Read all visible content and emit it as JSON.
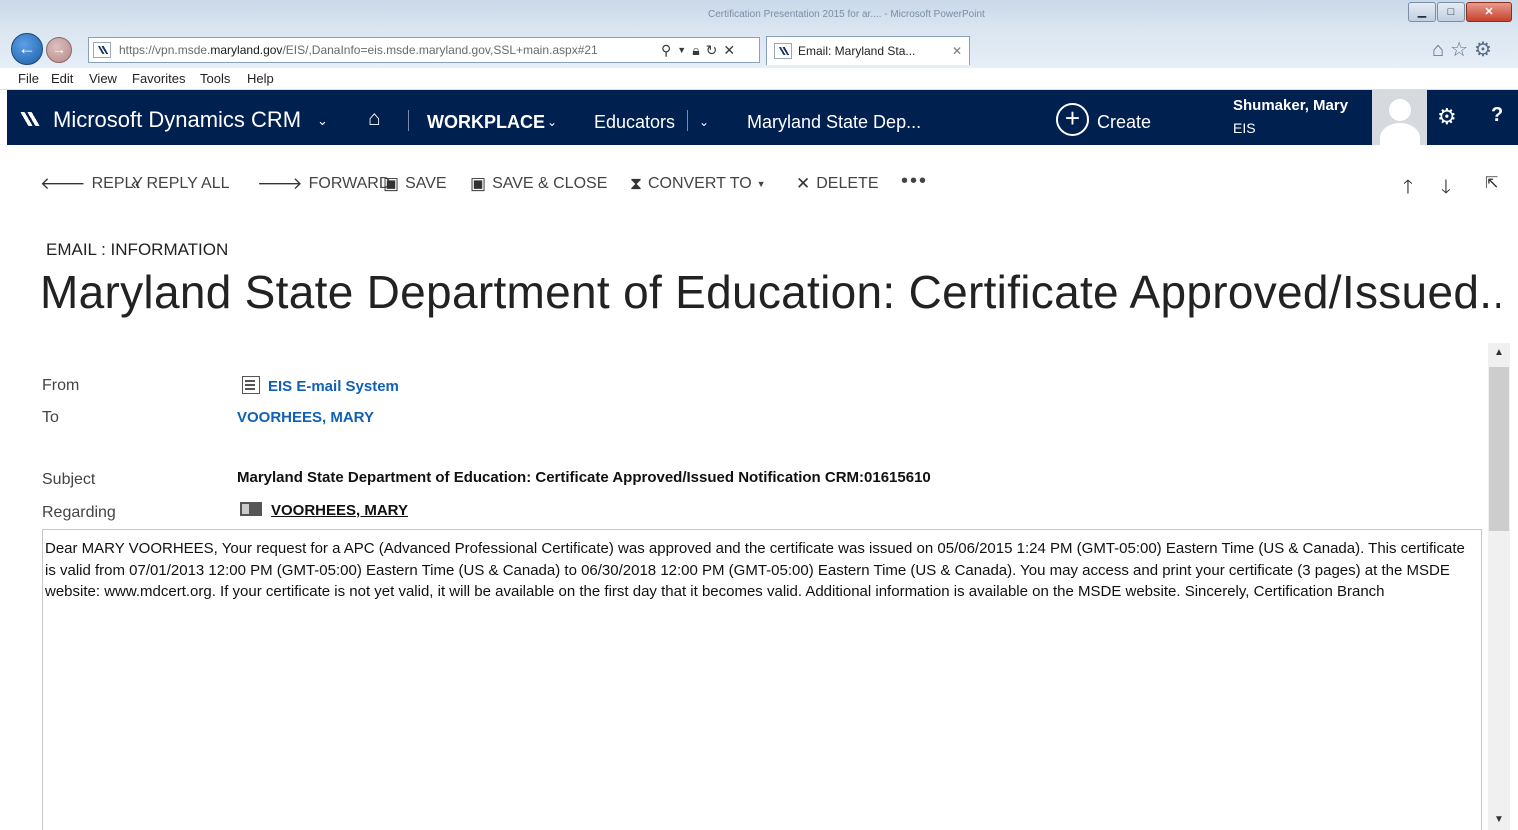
{
  "browser": {
    "window_title": "Certification Presentation 2015 for ar.... - Microsoft PowerPoint",
    "url_domain_prefix": "https://vpn.msde.",
    "url_domain_bold": "maryland.gov",
    "url_rest": "/EIS/,DanaInfo=eis.msde.maryland.gov,SSL+main.aspx#21",
    "tab_title": "Email: Maryland Sta...",
    "menu": [
      "File",
      "Edit",
      "View",
      "Favorites",
      "Tools",
      "Help"
    ]
  },
  "crm_nav": {
    "app_title": "Microsoft Dynamics CRM",
    "workplace": "WORKPLACE",
    "area": "Educators",
    "record": "Maryland State Dep...",
    "create_label": "Create",
    "user_name": "Shumaker, Mary",
    "user_org": "EIS"
  },
  "commands": {
    "reply": "REPLY",
    "reply_all": "REPLY ALL",
    "forward": "FORWARD",
    "save": "SAVE",
    "save_close": "SAVE & CLOSE",
    "convert_to": "CONVERT TO",
    "delete": "DELETE"
  },
  "header": {
    "entity_type": "EMAIL : INFORMATION",
    "title": "Maryland State Department of Education: Certificate Approved/Issued..."
  },
  "fields": {
    "from_label": "From",
    "from_value": "EIS E-mail System",
    "to_label": "To",
    "to_value": "VOORHEES, MARY",
    "subject_label": "Subject",
    "subject_value": "Maryland State Department of Education: Certificate Approved/Issued Notification CRM:01615610",
    "regarding_label": "Regarding",
    "regarding_value": "VOORHEES, MARY"
  },
  "body": {
    "text": "Dear MARY VOORHEES, Your request for a APC (Advanced Professional Certificate) was approved and the certificate was issued on 05/06/2015 1:24 PM (GMT-05:00) Eastern Time (US & Canada). This certificate is valid from 07/01/2013 12:00 PM (GMT-05:00) Eastern Time (US & Canada) to 06/30/2018 12:00 PM (GMT-05:00) Eastern Time (US & Canada). You may access and print your certificate (3 pages) at the MSDE website: www.mdcert.org. If your certificate is not yet valid, it will be available on the first day that it becomes valid. Additional information is available on the MSDE website. Sincerely, Certification Branch"
  },
  "colors": {
    "nav_background": "#002050",
    "link_blue": "#1160b7"
  }
}
